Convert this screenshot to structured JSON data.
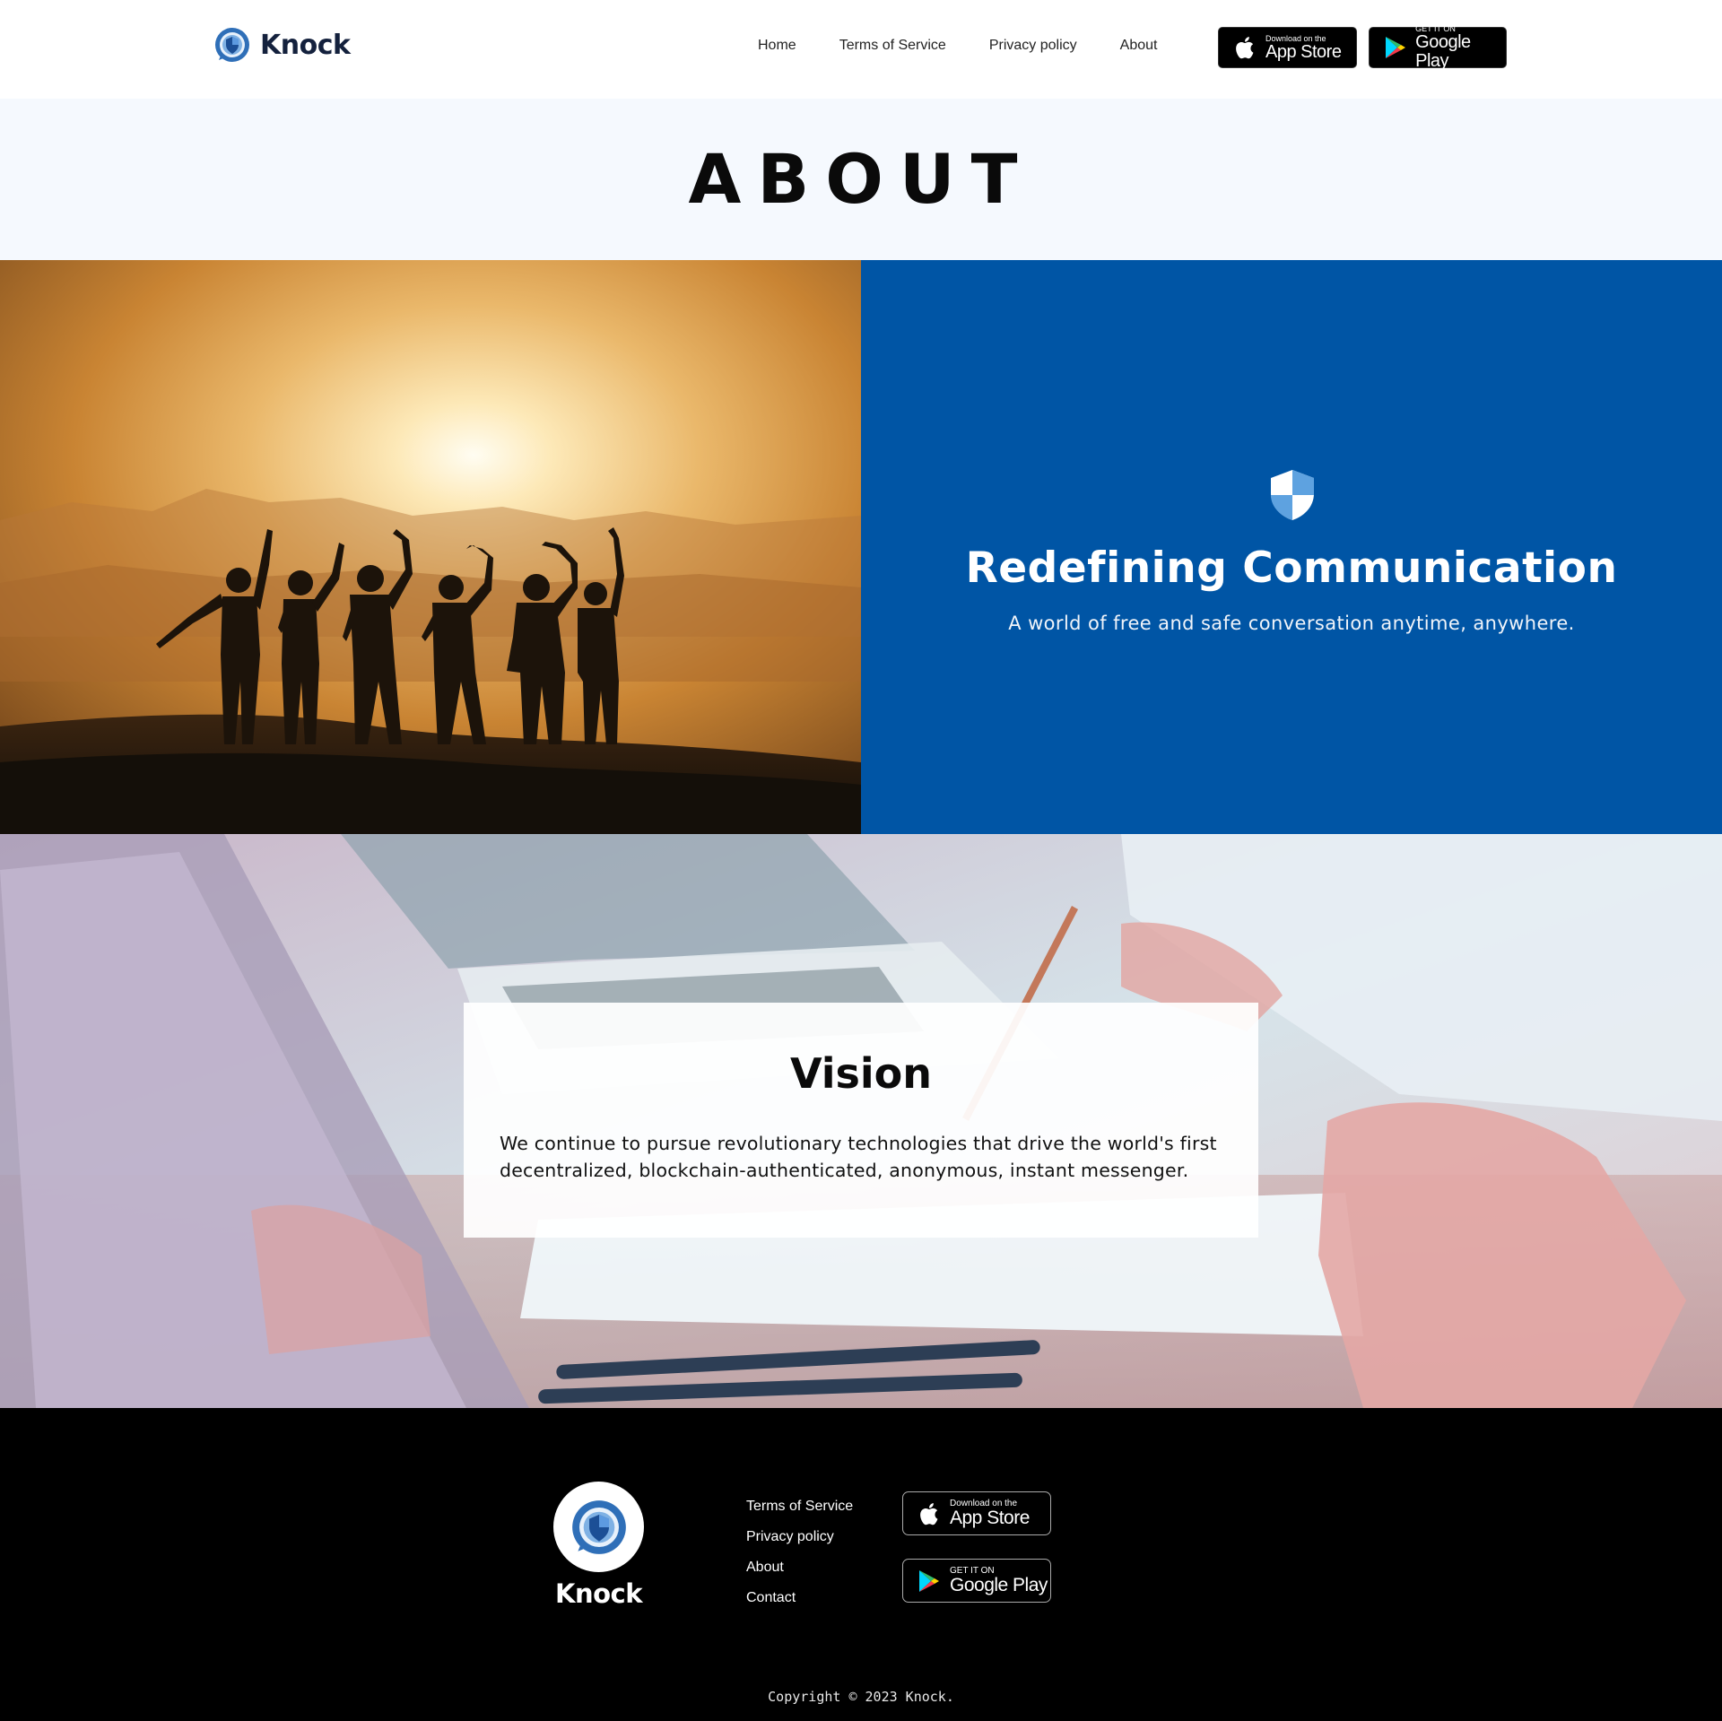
{
  "header": {
    "brand": "Knock",
    "nav": [
      "Home",
      "Terms of Service",
      "Privacy policy",
      "About"
    ],
    "app_store": {
      "small": "Download on the",
      "big": "App Store"
    },
    "google_play": {
      "small": "GET IT ON",
      "big": "Google Play"
    }
  },
  "page_title": "ABOUT",
  "hero": {
    "heading": "Redefining Communication",
    "subtext": "A world of free and safe conversation anytime, anywhere."
  },
  "vision": {
    "heading": "Vision",
    "body": "We continue to pursue revolutionary technologies that drive the world's first decentralized, blockchain-authenticated, anonymous, instant messenger."
  },
  "footer": {
    "brand": "Knock",
    "links": [
      "Terms of Service",
      "Privacy policy",
      "About",
      "Contact"
    ],
    "app_store": {
      "small": "Download on the",
      "big": "App Store"
    },
    "google_play": {
      "small": "GET IT ON",
      "big": "Google Play"
    },
    "copyright": "Copyright © 2023 Knock."
  },
  "colors": {
    "brand_blue": "#0055a5",
    "title_band_bg": "#f5f9fe",
    "logo_text": "#14213d",
    "footer_bg": "#000000"
  },
  "icons": [
    "knock-logo-icon",
    "apple-icon",
    "google-play-icon",
    "shield-icon"
  ]
}
